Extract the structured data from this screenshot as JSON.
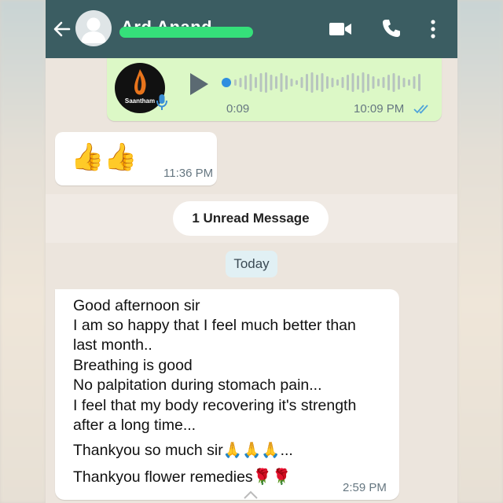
{
  "header": {
    "contact_name": "Ard Anand",
    "back_icon": "arrow-left-icon",
    "avatar_icon": "default-avatar-icon",
    "video_icon": "video-camera-icon",
    "call_icon": "phone-icon",
    "menu_icon": "more-vertical-icon",
    "color": "#3b5d62"
  },
  "voice_message": {
    "avatar_logo_text": "Saantham",
    "duration": "0:09",
    "time": "10:09 PM",
    "status_icon": "double-check-icon",
    "status_color": "#4fa3d9",
    "play_icon": "play-icon",
    "progress": 0
  },
  "reply_message": {
    "emoji": "👍👍",
    "time": "11:36 PM"
  },
  "unread_banner": "1 Unread Message",
  "date_chip": "Today",
  "incoming_message": {
    "lines": [
      "Good afternoon sir",
      "I am so happy that I feel much better than",
      "last month..",
      "Breathing is good",
      "No palpitation during  stomach pain...",
      "I feel that my body recovering it's strength",
      "after a long time...",
      "Thankyou so much sir🙏🙏🙏...",
      "Thankyou flower remedies🌹🌹"
    ],
    "time": "2:59 PM"
  },
  "colors": {
    "outgoing_bubble": "#dcf8c6",
    "incoming_bubble": "#ffffff",
    "chat_background": "#ece5dd"
  }
}
